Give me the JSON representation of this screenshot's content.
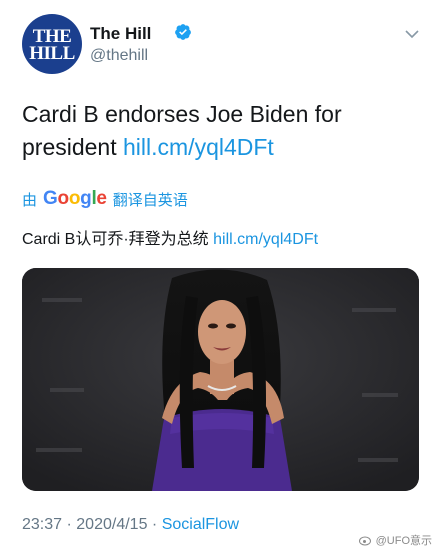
{
  "account": {
    "avatar_text_line1": "THE",
    "avatar_text_line2": "HILL",
    "name": "The Hill",
    "handle": "@thehill",
    "verified_icon": "verified-badge-icon",
    "menu_icon": "chevron-down-icon"
  },
  "tweet": {
    "text": "Cardi B endorses Joe Biden for president ",
    "link": "hill.cm/yql4DFt"
  },
  "translation": {
    "by_label": "由",
    "google_letters": [
      "G",
      "o",
      "o",
      "g",
      "l",
      "e"
    ],
    "action_label": "翻译自英语",
    "text": "Cardi B认可乔·拜登为总统",
    "link": "hill.cm/yql4DFt"
  },
  "media": {
    "description_icon": "photo-icon"
  },
  "meta": {
    "time": "23:37",
    "date": "2020/4/15",
    "separator": "·",
    "source": "SocialFlow"
  },
  "watermark": {
    "text": "@UFO意示"
  },
  "colors": {
    "link": "#1b95e0",
    "secondary_text": "#657786",
    "avatar_bg": "#1b3f8e",
    "verified": "#1da1f2"
  }
}
